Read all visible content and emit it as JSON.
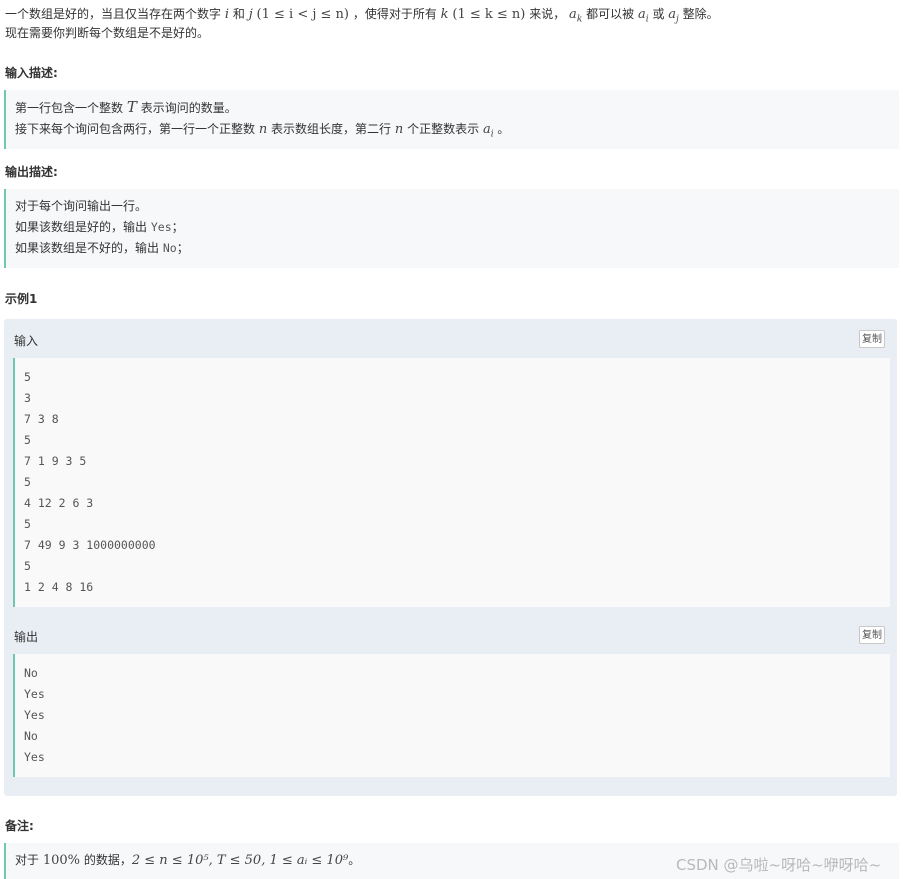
{
  "problem": {
    "intro_line1_a": "一个数组是好的，当且仅当存在两个数字",
    "var_i": "i",
    "word_and": "和",
    "var_j": "j",
    "cond_ij": "(1 ≤ i < j ≤ n)",
    "intro_line1_b": "，使得对于所有",
    "var_k": "k",
    "cond_k": "(1 ≤ k ≤ n)",
    "intro_line1_c": "来说，",
    "var_ak": "a",
    "sub_k": "k",
    "intro_line1_d": "都可以被",
    "var_ai": "a",
    "sub_i": "i",
    "word_or": "或",
    "var_aj": "a",
    "sub_j": "j",
    "intro_line1_e": "整除。",
    "intro_line2": "现在需要你判断每个数组是不是好的。"
  },
  "input_desc": {
    "heading": "输入描述:",
    "line1_a": "第一行包含一个整数",
    "var_T": "T",
    "line1_b": "表示询问的数量。",
    "line2_a": "接下来每个询问包含两行，第一行一个正整数",
    "var_n": "n",
    "line2_b": "表示数组长度，第二行",
    "var_n2": "n",
    "line2_c": "个正整数表示",
    "var_a": "a",
    "sub_i": "i",
    "line2_d": "。"
  },
  "output_desc": {
    "heading": "输出描述:",
    "line1": "对于每个询问输出一行。",
    "line2_a": "如果该数组是好的，输出",
    "yes": "Yes",
    "line2_b": "；",
    "line3_a": "如果该数组是不好的，输出",
    "no": "No",
    "line3_b": "；"
  },
  "example": {
    "heading": "示例1",
    "input_label": "输入",
    "output_label": "输出",
    "copy_label": "复制",
    "input_lines": [
      "5",
      "3",
      "7 3 8",
      "5",
      "7 1 9 3 5",
      "5",
      "4 12 2 6 3",
      "5",
      "7 49 9 3 1000000000",
      "5",
      "1 2 4 8 16"
    ],
    "output_lines": [
      "No",
      "Yes",
      "Yes",
      "No",
      "Yes"
    ]
  },
  "note": {
    "heading": "备注:",
    "prefix": "对于",
    "percent": "100%",
    "middle": "的数据，",
    "constraints": "2 ≤ n ≤ 10⁵, T ≤ 50, 1 ≤ aᵢ ≤ 10⁹",
    "suffix": "。"
  },
  "watermark": "CSDN @乌啦~呀哈~咿呀哈~"
}
